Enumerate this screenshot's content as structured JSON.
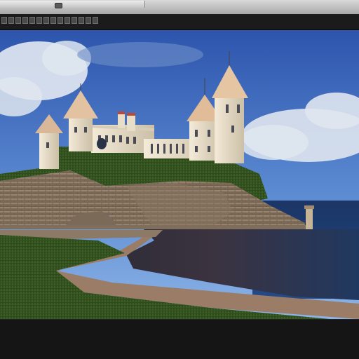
{
  "window": {
    "title": ""
  },
  "toolbar": {
    "tools": [
      {
        "icon": "tool-1-icon"
      },
      {
        "icon": "tool-2-icon"
      },
      {
        "icon": "tool-3-icon"
      },
      {
        "icon": "tool-4-icon"
      },
      {
        "icon": "tool-5-icon"
      },
      {
        "icon": "tool-6-icon"
      },
      {
        "icon": "tool-7-icon"
      },
      {
        "icon": "tool-8-icon"
      },
      {
        "icon": "tool-9-icon"
      },
      {
        "icon": "tool-10-icon"
      },
      {
        "icon": "tool-11-icon"
      },
      {
        "icon": "tool-12-icon"
      },
      {
        "icon": "tool-13-icon"
      },
      {
        "icon": "tool-14-icon"
      }
    ]
  },
  "viewport": {
    "scene": "castle-on-cliff-by-sea",
    "colors": {
      "sky": "#3b62b0",
      "sea": "#1f3a6b",
      "grass": "#2c4a1c",
      "stone": "#8c7b68"
    }
  },
  "statusbar": {
    "text": ""
  }
}
